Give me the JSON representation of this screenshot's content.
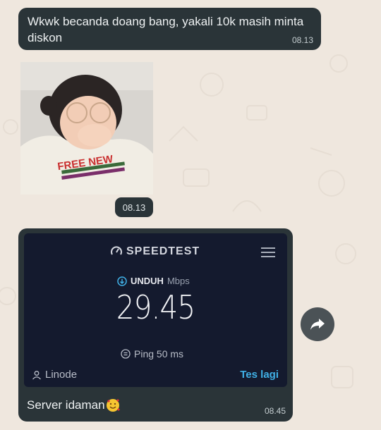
{
  "messages": {
    "first": {
      "text": "Wkwk becanda doang bang, yakali 10k masih minta diskon",
      "time": "08.13"
    },
    "sticker": {
      "time": "08.13",
      "shirt_text": "FREE NEW"
    },
    "speedtest": {
      "brand": "SPEEDTEST",
      "unit_label": "UNDUH",
      "unit": "Mbps",
      "value": "29.45",
      "ping": "Ping 50 ms",
      "server": "Linode",
      "retest": "Tes lagi",
      "caption": "Server idaman",
      "time": "08.45"
    }
  },
  "icons": [
    "speed-gauge-icon",
    "menu-icon",
    "download-icon",
    "ping-icon",
    "user-icon",
    "smiling-face-with-hearts-emoji",
    "share-icon"
  ],
  "colors": {
    "bubble": "#2a3438",
    "background": "#efe7de",
    "accent": "#40b0e6"
  }
}
